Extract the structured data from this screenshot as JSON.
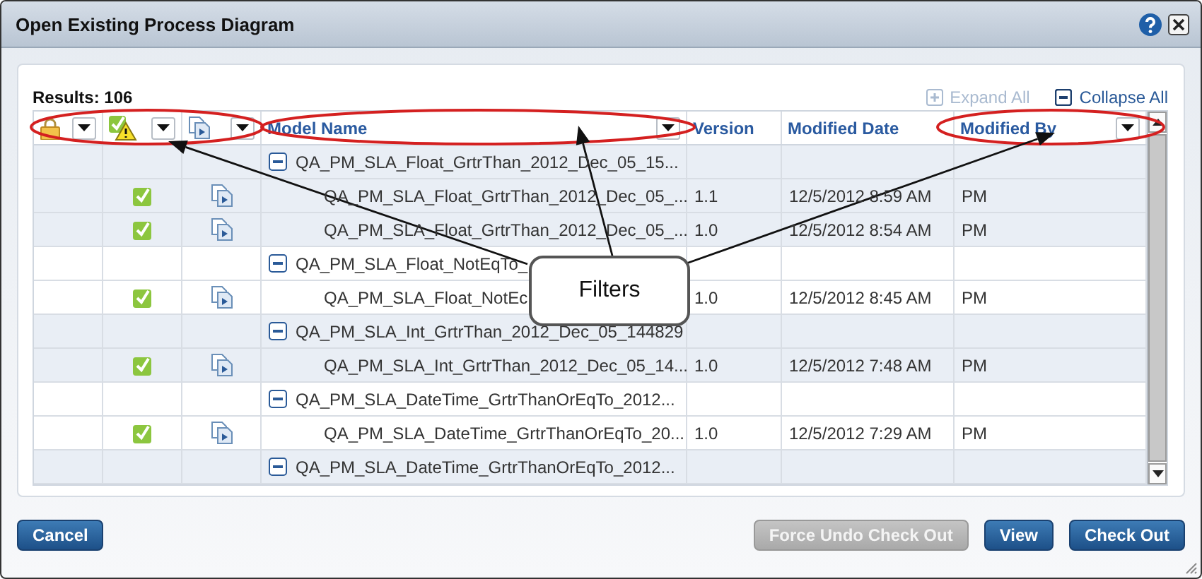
{
  "window": {
    "title": "Open Existing Process Diagram"
  },
  "results": "Results: 106",
  "expand_all": {
    "label": "Expand All",
    "disabled": true
  },
  "collapse_all": {
    "label": "Collapse All",
    "disabled": false
  },
  "columns": [
    {
      "kind": "icon",
      "filter": true
    },
    {
      "kind": "icon",
      "filter": true
    },
    {
      "kind": "icon",
      "filter": true
    },
    {
      "kind": "text",
      "label": "Model Name",
      "filter": true
    },
    {
      "kind": "text",
      "label": "Version",
      "filter": false
    },
    {
      "kind": "text",
      "label": "Modified Date",
      "filter": false
    },
    {
      "kind": "text",
      "label": "Modified By",
      "filter": true
    }
  ],
  "rows": [
    {
      "kind": "group",
      "expanded": true,
      "name": "QA_PM_SLA_Float_GrtrThan_2012_Dec_05_15..."
    },
    {
      "kind": "item",
      "name": "QA_PM_SLA_Float_GrtrThan_2012_Dec_05_...",
      "version": "1.1",
      "modified_date": "12/5/2012 8:59 AM",
      "modified_by": "PM"
    },
    {
      "kind": "item",
      "name": "QA_PM_SLA_Float_GrtrThan_2012_Dec_05_...",
      "version": "1.0",
      "modified_date": "12/5/2012 8:54 AM",
      "modified_by": "PM"
    },
    {
      "kind": "group",
      "expanded": true,
      "name": "QA_PM_SLA_Float_NotEqTo_"
    },
    {
      "kind": "item",
      "name": "QA_PM_SLA_Float_NotEc",
      "version": "1.0",
      "modified_date": "12/5/2012 8:45 AM",
      "modified_by": "PM"
    },
    {
      "kind": "group",
      "expanded": true,
      "name": "QA_PM_SLA_Int_GrtrThan_2012_Dec_05_144829"
    },
    {
      "kind": "item",
      "name": "QA_PM_SLA_Int_GrtrThan_2012_Dec_05_14...",
      "version": "1.0",
      "modified_date": "12/5/2012 7:48 AM",
      "modified_by": "PM"
    },
    {
      "kind": "group",
      "expanded": true,
      "name": "QA_PM_SLA_DateTime_GrtrThanOrEqTo_2012..."
    },
    {
      "kind": "item",
      "name": "QA_PM_SLA_DateTime_GrtrThanOrEqTo_20...",
      "version": "1.0",
      "modified_date": "12/5/2012 7:29 AM",
      "modified_by": "PM"
    },
    {
      "kind": "group",
      "expanded": true,
      "name": "QA_PM_SLA_DateTime_GrtrThanOrEqTo_2012..."
    }
  ],
  "callout": "Filters",
  "left_buttons": [
    {
      "label": "Cancel",
      "disabled": false
    }
  ],
  "right_buttons": [
    {
      "label": "Force Undo Check Out",
      "disabled": true
    },
    {
      "label": "View",
      "disabled": false
    },
    {
      "label": "Check Out",
      "disabled": false
    }
  ]
}
